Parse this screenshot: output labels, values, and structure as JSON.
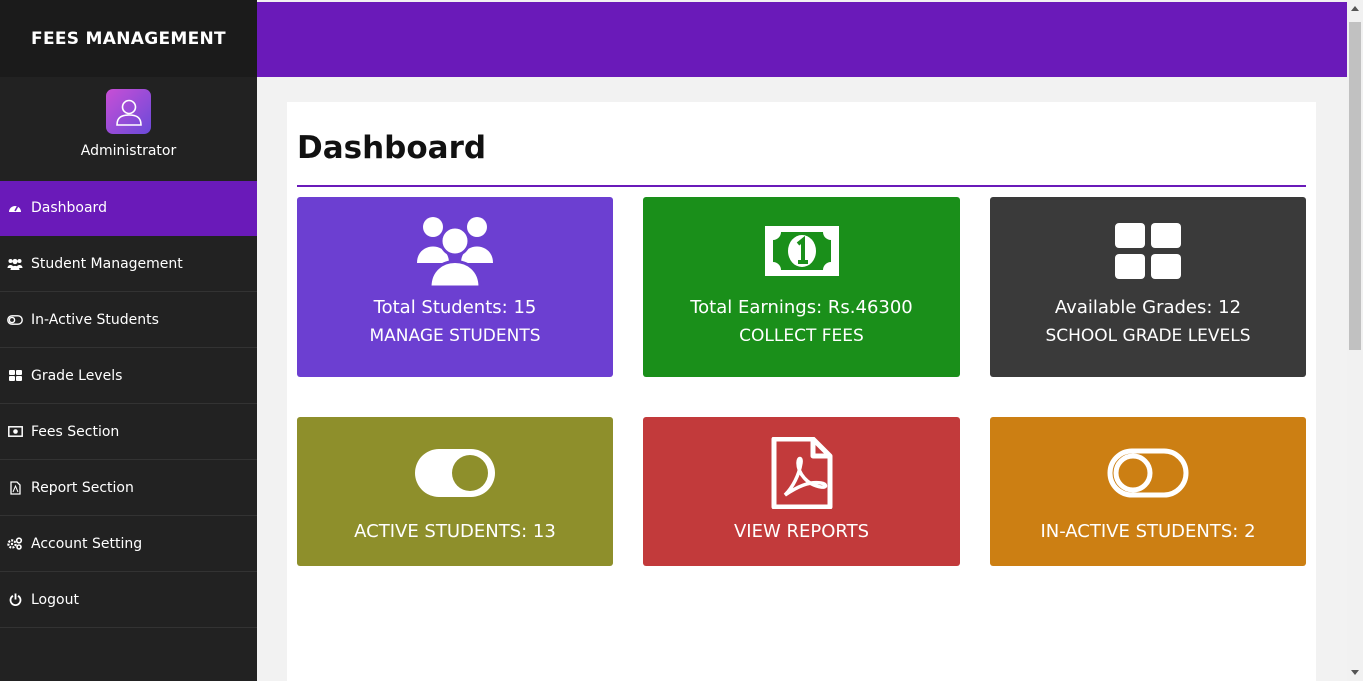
{
  "brand": {
    "title": "FEES MANAGEMENT"
  },
  "profile": {
    "name": "Administrator",
    "icon": "user-icon"
  },
  "sidebar": {
    "items": [
      {
        "label": "Dashboard",
        "icon": "dashboard-icon",
        "active": true
      },
      {
        "label": "Student Management",
        "icon": "users-icon",
        "active": false
      },
      {
        "label": "In-Active Students",
        "icon": "toggle-off-icon",
        "active": false
      },
      {
        "label": "Grade Levels",
        "icon": "grid-icon",
        "active": false
      },
      {
        "label": "Fees Section",
        "icon": "money-icon",
        "active": false
      },
      {
        "label": "Report Section",
        "icon": "pdf-file-icon",
        "active": false
      },
      {
        "label": "Account Setting",
        "icon": "cogs-icon",
        "active": false
      },
      {
        "label": "Logout",
        "icon": "power-icon",
        "active": false
      }
    ]
  },
  "main": {
    "title": "Dashboard",
    "cards": [
      {
        "line1": "Total Students: 15",
        "line2": "MANAGE STUDENTS",
        "icon": "users-icon",
        "color": "#6c3fd1"
      },
      {
        "line1": "Total Earnings: Rs.46300",
        "line2": "COLLECT FEES",
        "icon": "money-bill-icon",
        "color": "#1a8f1a"
      },
      {
        "line1": "Available Grades: 12",
        "line2": "SCHOOL GRADE LEVELS",
        "icon": "grid-icon",
        "color": "#3a3a3a"
      },
      {
        "line1": "ACTIVE STUDENTS: 13",
        "icon": "toggle-on-icon",
        "color": "#8e8f2b"
      },
      {
        "line1": "VIEW REPORTS",
        "icon": "pdf-file-icon",
        "color": "#c23a3b"
      },
      {
        "line1": "IN-ACTIVE STUDENTS: 2",
        "icon": "toggle-off-icon",
        "color": "#cc7f13"
      }
    ]
  },
  "colors": {
    "accent": "#6a1ab9",
    "sidebar": "#222222"
  }
}
